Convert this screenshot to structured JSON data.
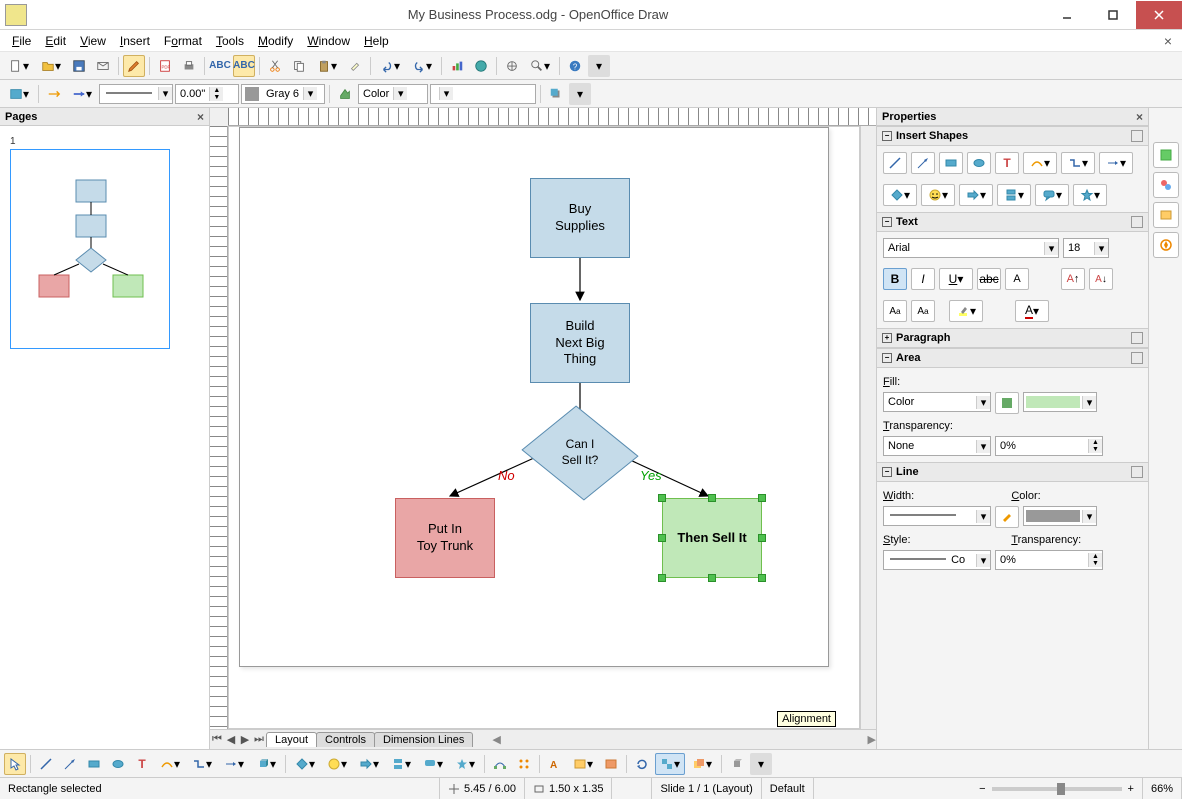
{
  "title": "My Business Process.odg - OpenOffice Draw",
  "menus": [
    "File",
    "Edit",
    "View",
    "Insert",
    "Format",
    "Tools",
    "Modify",
    "Window",
    "Help"
  ],
  "toolbar2": {
    "line_width": "0.00\"",
    "color_name": "Gray 6",
    "fill_mode": "Color"
  },
  "pages_panel": {
    "title": "Pages",
    "page_num": "1"
  },
  "shapes": {
    "box1": "Buy\nSupplies",
    "box2": "Build\nNext Big\nThing",
    "diamond": "Can I\nSell It?",
    "red": "Put In\nToy Trunk",
    "green": "Then Sell It",
    "no": "No",
    "yes": "Yes"
  },
  "tabs": [
    "Layout",
    "Controls",
    "Dimension Lines"
  ],
  "tooltip": "Alignment",
  "props": {
    "title": "Properties",
    "sec_shapes": "Insert Shapes",
    "sec_text": "Text",
    "font": "Arial",
    "size": "18",
    "sec_para": "Paragraph",
    "sec_area": "Area",
    "fill_label": "Fill:",
    "fill_mode": "Color",
    "trans_label": "Transparency:",
    "trans_mode": "None",
    "trans_val": "0%",
    "sec_line": "Line",
    "width_label": "Width:",
    "color_label": "Color:",
    "style_label": "Style:",
    "style_val": "Co",
    "line_trans_label": "Transparency:",
    "line_trans_val": "0%"
  },
  "status": {
    "sel": "Rectangle selected",
    "pos": "5.45 / 6.00",
    "size": "1.50 x 1.35",
    "slide": "Slide 1 / 1 (Layout)",
    "style": "Default",
    "zoom": "66%"
  }
}
